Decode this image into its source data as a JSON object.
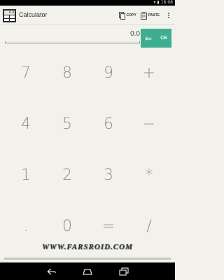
{
  "status_bar": {
    "time": "16:08"
  },
  "app_bar": {
    "title": "Calculator",
    "icon_screen_value": "0.0",
    "copy_label": "COPY",
    "paste_label": "PASTE"
  },
  "display": {
    "value": "0.0",
    "ce_label": "CE"
  },
  "keypad": {
    "keys": [
      "7",
      "8",
      "9",
      "+",
      "4",
      "5",
      "6",
      "−",
      "1",
      "2",
      "3",
      "*",
      ".",
      "0",
      "=",
      "/"
    ]
  },
  "watermark": "WWW.FARSROID.COM",
  "colors": {
    "accent": "#3fae8e",
    "background": "#f2f1ec",
    "key_text": "#8f8f8b"
  },
  "icons": {
    "copy": "copy-icon",
    "paste": "paste-icon",
    "overflow": "overflow-menu-icon",
    "back_arrow": "back-arrow-icon",
    "nav_back": "nav-back-icon",
    "nav_home": "nav-home-icon",
    "nav_recents": "nav-recents-icon"
  }
}
